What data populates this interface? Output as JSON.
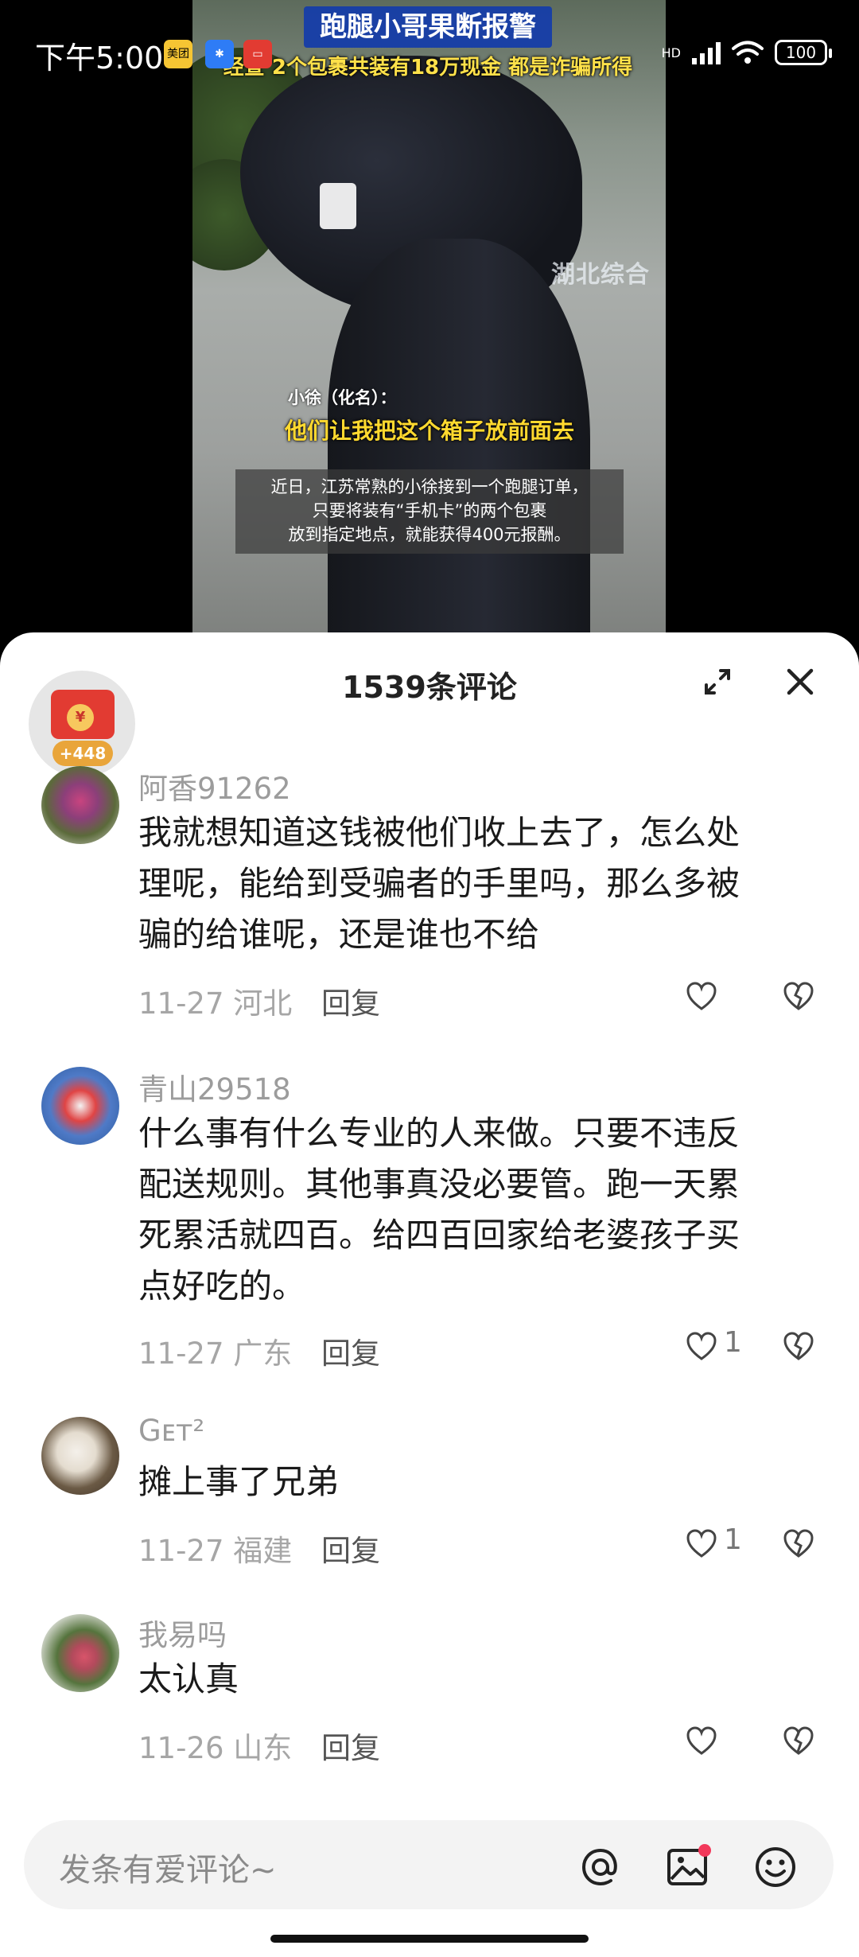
{
  "status_bar": {
    "time": "下午5:00",
    "app_icon_1": "美团",
    "network": "HD",
    "battery": "100"
  },
  "video": {
    "title": "跑腿小哥果断报警",
    "subtitle": "经查 2个包裹共装有18万现金 都是诈骗所得",
    "watermark": "湖北综合",
    "speaker_name": "小徐（化名）：",
    "speaker_line": "他们让我把这个箱子放前面去",
    "caption_lines": [
      "近日，江苏常熟的小徐接到一个跑腿订单，",
      "只要将装有“手机卡”的两个包裹",
      "放到指定地点，就能获得400元报酬。"
    ]
  },
  "sheet": {
    "title": "1539条评论",
    "redpack_coin": "¥",
    "redpack_badge": "+448"
  },
  "comments": [
    {
      "name": "阿香91262",
      "lines": [
        "我就想知道这钱被他们收上去了，怎么处",
        "理呢，能给到受骗者的手里吗，那么多被",
        "骗的给谁呢，还是谁也不给"
      ],
      "date": "11-27 河北",
      "reply": "回复",
      "likes": ""
    },
    {
      "name": "青山29518",
      "lines": [
        "什么事有什么专业的人来做。只要不违反",
        "配送规则。其他事真没必要管。跑一天累",
        "死累活就四百。给四百回家给老婆孩子买",
        "点好吃的。"
      ],
      "date": "11-27 广东",
      "reply": "回复",
      "likes": "1"
    },
    {
      "name": "Gᴇᴛ²",
      "lines": [
        "摊上事了兄弟"
      ],
      "date": "11-27 福建",
      "reply": "回复",
      "likes": "1"
    },
    {
      "name": "我易吗",
      "lines": [
        "太认真"
      ],
      "date": "11-26 山东",
      "reply": "回复",
      "likes": ""
    }
  ],
  "input": {
    "placeholder": "发条有爱评论~"
  },
  "colors": {
    "accent_red": "#e23b32",
    "sheet_bg": "#ffffff",
    "input_bg": "#f3f3f3"
  }
}
